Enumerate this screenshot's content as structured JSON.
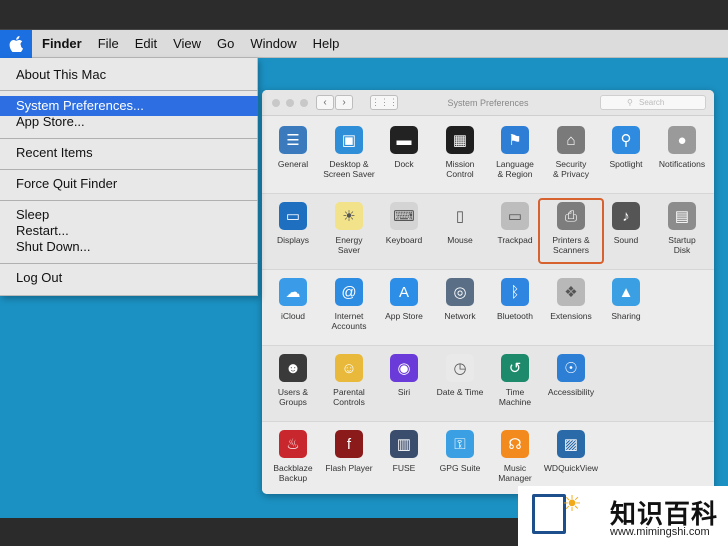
{
  "menubar": {
    "app_name": "Finder",
    "items": [
      "File",
      "Edit",
      "View",
      "Go",
      "Window",
      "Help"
    ]
  },
  "apple_menu": {
    "items": [
      {
        "label": "About This Mac",
        "selected": false
      },
      {
        "label": "System Preferences...",
        "selected": true
      },
      {
        "label": "App Store...",
        "selected": false
      },
      {
        "label": "Recent Items",
        "selected": false
      },
      {
        "label": "Force Quit Finder",
        "selected": false
      },
      {
        "label": "Sleep",
        "selected": false
      },
      {
        "label": "Restart...",
        "selected": false
      },
      {
        "label": "Shut Down...",
        "selected": false
      },
      {
        "label": "Log Out",
        "selected": false
      }
    ]
  },
  "window": {
    "title": "System Preferences",
    "search_placeholder": "Search",
    "rows": [
      [
        {
          "label": "General",
          "icon": "general-icon",
          "color": "#3b7bbd"
        },
        {
          "label": "Desktop &\nScreen Saver",
          "icon": "desktop-icon",
          "color": "#2e8fd8"
        },
        {
          "label": "Dock",
          "icon": "dock-icon",
          "color": "#222222"
        },
        {
          "label": "Mission\nControl",
          "icon": "mission-control-icon",
          "color": "#1f1f1f"
        },
        {
          "label": "Language\n& Region",
          "icon": "language-icon",
          "color": "#2f7ed6"
        },
        {
          "label": "Security\n& Privacy",
          "icon": "security-icon",
          "color": "#7a7a7a"
        },
        {
          "label": "Spotlight",
          "icon": "spotlight-icon",
          "color": "#2f8be0"
        },
        {
          "label": "Notifications",
          "icon": "notifications-icon",
          "color": "#9a9a9a"
        }
      ],
      [
        {
          "label": "Displays",
          "icon": "displays-icon",
          "color": "#1f6fc0"
        },
        {
          "label": "Energy\nSaver",
          "icon": "energy-icon",
          "color": "#f2e28a"
        },
        {
          "label": "Keyboard",
          "icon": "keyboard-icon",
          "color": "#d4d4d4"
        },
        {
          "label": "Mouse",
          "icon": "mouse-icon",
          "color": "#e6e6e6"
        },
        {
          "label": "Trackpad",
          "icon": "trackpad-icon",
          "color": "#bdbdbd"
        },
        {
          "label": "Printers &\nScanners",
          "icon": "printer-icon",
          "color": "#7d7d7d"
        },
        {
          "label": "Sound",
          "icon": "sound-icon",
          "color": "#555555"
        },
        {
          "label": "Startup\nDisk",
          "icon": "startup-disk-icon",
          "color": "#8c8c8c"
        }
      ],
      [
        {
          "label": "iCloud",
          "icon": "icloud-icon",
          "color": "#3a9be8"
        },
        {
          "label": "Internet\nAccounts",
          "icon": "internet-accounts-icon",
          "color": "#2c8ce2"
        },
        {
          "label": "App Store",
          "icon": "app-store-icon",
          "color": "#2d8ee8"
        },
        {
          "label": "Network",
          "icon": "network-icon",
          "color": "#5a6f86"
        },
        {
          "label": "Bluetooth",
          "icon": "bluetooth-icon",
          "color": "#2f86e0"
        },
        {
          "label": "Extensions",
          "icon": "extensions-icon",
          "color": "#b8b8b8"
        },
        {
          "label": "Sharing",
          "icon": "sharing-icon",
          "color": "#3aa0e3"
        }
      ],
      [
        {
          "label": "Users &\nGroups",
          "icon": "users-icon",
          "color": "#3a3a3a"
        },
        {
          "label": "Parental\nControls",
          "icon": "parental-controls-icon",
          "color": "#e8b93a"
        },
        {
          "label": "Siri",
          "icon": "siri-icon",
          "color": "#6a3bd8"
        },
        {
          "label": "Date & Time",
          "icon": "date-time-icon",
          "color": "#e9e9e9"
        },
        {
          "label": "Time\nMachine",
          "icon": "time-machine-icon",
          "color": "#1d8a6b"
        },
        {
          "label": "Accessibility",
          "icon": "accessibility-icon",
          "color": "#2d7fd6"
        }
      ],
      [
        {
          "label": "Backblaze\nBackup",
          "icon": "backblaze-icon",
          "color": "#c8282d"
        },
        {
          "label": "Flash Player",
          "icon": "flash-icon",
          "color": "#8b1a1a"
        },
        {
          "label": "FUSE",
          "icon": "fuse-icon",
          "color": "#3a4d6c"
        },
        {
          "label": "GPG Suite",
          "icon": "gpg-icon",
          "color": "#3aa0e3"
        },
        {
          "label": "Music\nManager",
          "icon": "music-manager-icon",
          "color": "#f28a1d"
        },
        {
          "label": "WDQuickView",
          "icon": "wd-quickview-icon",
          "color": "#2b6aa8"
        }
      ]
    ],
    "highlighted": "Printers &\nScanners"
  },
  "watermark": {
    "name": "知识百科",
    "url": "www.mimingshi.com"
  }
}
